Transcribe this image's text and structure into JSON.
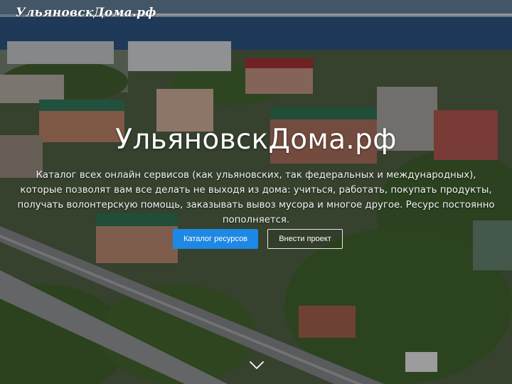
{
  "header": {
    "logo_text": "УльяновскДома.рф"
  },
  "hero": {
    "title": "УльяновскДома.рф",
    "description": "Каталог всех онлайн сервисов (как ульяновских, так федеральных и международных), которые позволят вам все делать не выходя из дома: учиться, работать, покупать продукты, получать волонтерскую помощь, заказывать вывоз мусора и многое другое. Ресурс постоянно пополняется.",
    "primary_button_label": "Каталог ресурсов",
    "secondary_button_label": "Внести проект",
    "scroll_icon": "chevron-down-icon"
  },
  "colors": {
    "primary_button": "#1e88e5",
    "river": "#2c4f7a",
    "text": "#ffffff"
  }
}
